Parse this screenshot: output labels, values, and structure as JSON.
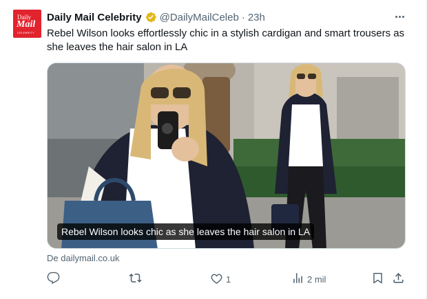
{
  "tweet": {
    "author": {
      "avatar": {
        "line1": "Daily",
        "line2": "Mail",
        "line3": "CELEBRITY"
      },
      "name": "Daily Mail Celebrity",
      "handle": "@DailyMailCeleb",
      "separator": "·",
      "time": "23h",
      "verified_icon": "verified-badge-icon"
    },
    "more_icon": "more-options-icon",
    "text": "Rebel Wilson looks effortlessly chic in a stylish cardigan and smart trousers as she leaves the hair salon in LA",
    "media": {
      "caption": "Rebel Wilson looks chic as she leaves the hair salon in LA"
    },
    "source": "De dailymail.co.uk",
    "actions": {
      "reply": {
        "icon": "reply-icon",
        "count": ""
      },
      "retweet": {
        "icon": "retweet-icon",
        "count": ""
      },
      "like": {
        "icon": "heart-icon",
        "count": "1"
      },
      "views": {
        "icon": "views-icon",
        "count": "2 mil"
      },
      "bookmark": {
        "icon": "bookmark-icon"
      },
      "share": {
        "icon": "share-icon"
      }
    }
  },
  "colors": {
    "brand": "#e1232e",
    "verified_gold": "#e2b719",
    "text_primary": "#0f1419",
    "text_secondary": "#536471"
  }
}
